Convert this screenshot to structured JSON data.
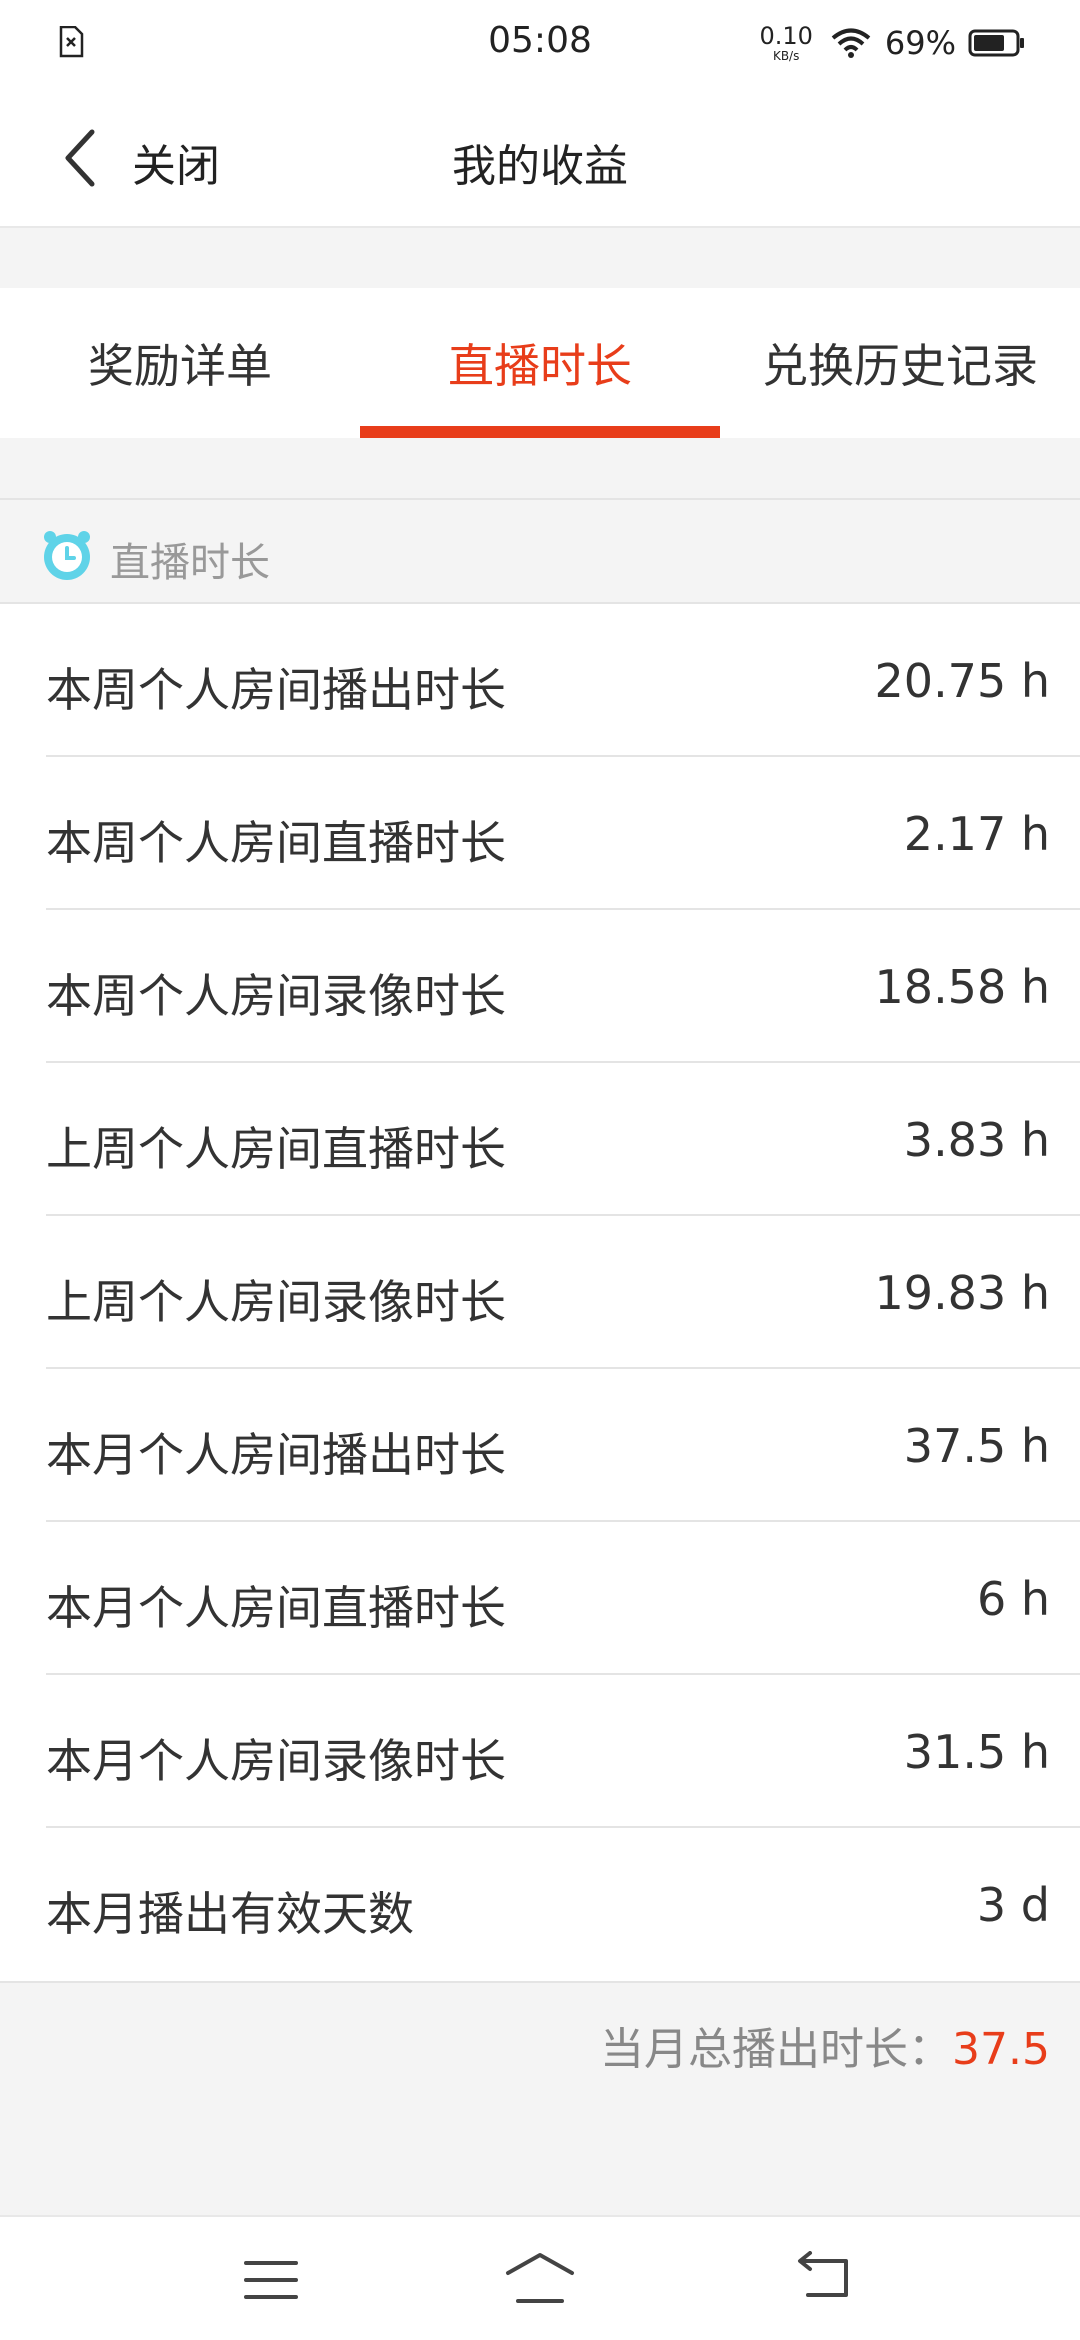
{
  "status_bar": {
    "time": "05:08",
    "net_speed_value": "0.10",
    "net_speed_unit": "KB/s",
    "battery": "69%",
    "icons": [
      "file-close-icon",
      "wifi-icon",
      "battery-icon"
    ]
  },
  "nav": {
    "back_label": "关闭",
    "title": "我的收益"
  },
  "tabs": [
    {
      "label": "奖励详单",
      "active": false
    },
    {
      "label": "直播时长",
      "active": true
    },
    {
      "label": "兑换历史记录",
      "active": false
    }
  ],
  "section": {
    "label": "直播时长",
    "icon": "alarm-clock-icon"
  },
  "rows": [
    {
      "label": "本周个人房间播出时长",
      "value": "20.75 h"
    },
    {
      "label": "本周个人房间直播时长",
      "value": "2.17 h"
    },
    {
      "label": "本周个人房间录像时长",
      "value": "18.58 h"
    },
    {
      "label": "上周个人房间直播时长",
      "value": "3.83 h"
    },
    {
      "label": "上周个人房间录像时长",
      "value": "19.83 h"
    },
    {
      "label": "本月个人房间播出时长",
      "value": "37.5 h"
    },
    {
      "label": "本月个人房间直播时长",
      "value": "6 h"
    },
    {
      "label": "本月个人房间录像时长",
      "value": "31.5 h"
    },
    {
      "label": "本月播出有效天数",
      "value": "3 d"
    }
  ],
  "total": {
    "label": "当月总播出时长：",
    "value": "37.5"
  },
  "colors": {
    "accent": "#e83d1a",
    "clock_icon": "#5fd3e8"
  }
}
